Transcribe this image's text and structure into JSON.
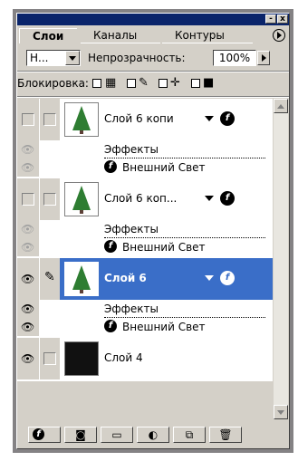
{
  "window": {
    "minimize_label": "-",
    "close_label": "x"
  },
  "tabs": [
    {
      "label": "Слои",
      "active": true
    },
    {
      "label": "Каналы",
      "active": false
    },
    {
      "label": "Контуры",
      "active": false
    }
  ],
  "blend_mode": {
    "value": "Н..."
  },
  "opacity": {
    "label": "Непрозрачность:",
    "value": "100%"
  },
  "lock": {
    "label": "Блокировка:",
    "icons": [
      "lock-transparent-icon",
      "lock-image-icon",
      "lock-position-icon",
      "lock-all-icon"
    ]
  },
  "layers": [
    {
      "name": "Слой 6 копи",
      "visible": false,
      "linked": false,
      "selected": false,
      "effects_label": "Эффекты",
      "effect": "Внешний Свет"
    },
    {
      "name": "Слой 6 коп...",
      "visible": false,
      "linked": false,
      "selected": false,
      "effects_label": "Эффекты",
      "effect": "Внешний Свет"
    },
    {
      "name": "Слой 6",
      "visible": true,
      "linked": true,
      "selected": true,
      "effects_label": "Эффекты",
      "effect": "Внешний Свет"
    },
    {
      "name": "Слой 4",
      "visible": true,
      "linked": false,
      "selected": false
    }
  ],
  "fx_glyph": "f",
  "colors": {
    "selection": "#3a6ec8",
    "panel": "#d4d0c8",
    "title": "#0a246a"
  },
  "bottom_buttons": [
    "add-style-icon",
    "add-mask-icon",
    "new-set-icon",
    "new-fill-layer-icon",
    "new-layer-icon",
    "trash-icon"
  ]
}
